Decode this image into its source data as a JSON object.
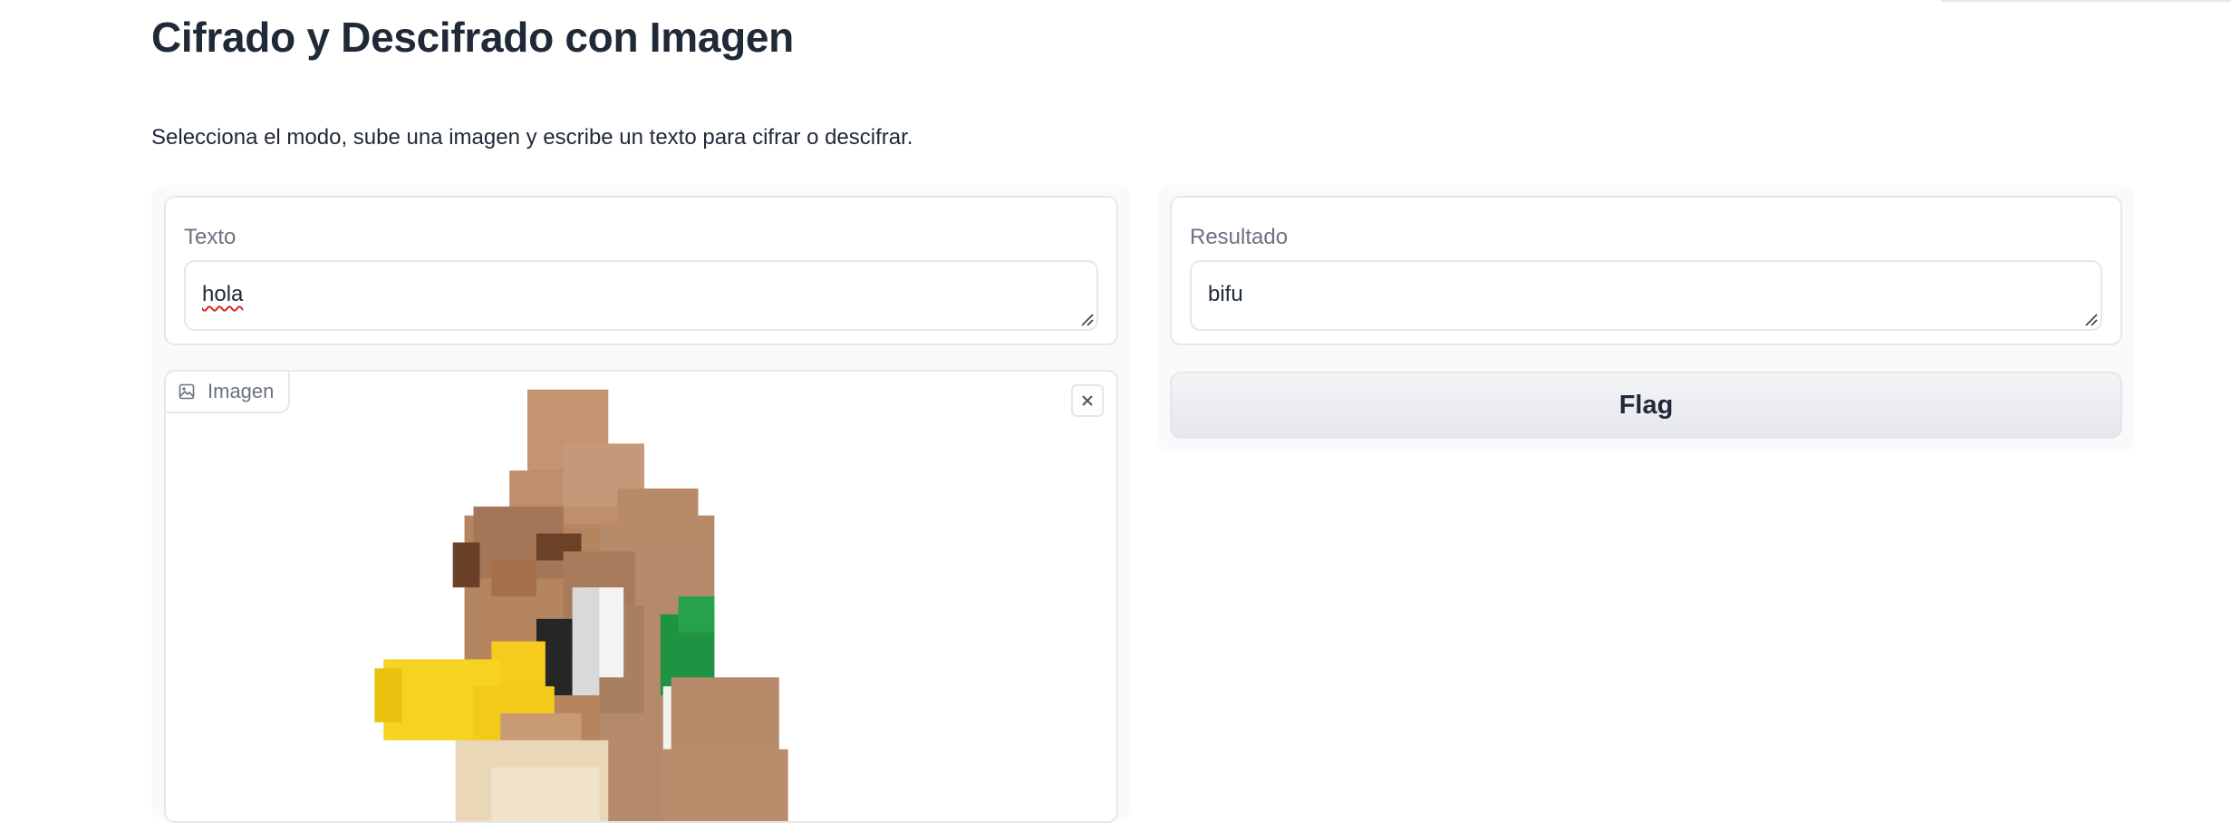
{
  "page": {
    "title": "Cifrado y Descifrado con Imagen",
    "description": "Selecciona el modo, sube una imagen y escribe un texto para cifrar o descifrar."
  },
  "inputs": {
    "text_label": "Texto",
    "text_value": "hola",
    "image_label": "Imagen"
  },
  "outputs": {
    "result_label": "Resultado",
    "result_value": "bifu",
    "flag_label": "Flag"
  },
  "icons": {
    "image_tag": "image-icon",
    "clear_image": "close-icon",
    "resize": "resize-handle-icon"
  },
  "colors": {
    "border": "#e5e7eb",
    "label": "#6b7280",
    "text": "#1f2937",
    "panel": "#f9fafb"
  }
}
